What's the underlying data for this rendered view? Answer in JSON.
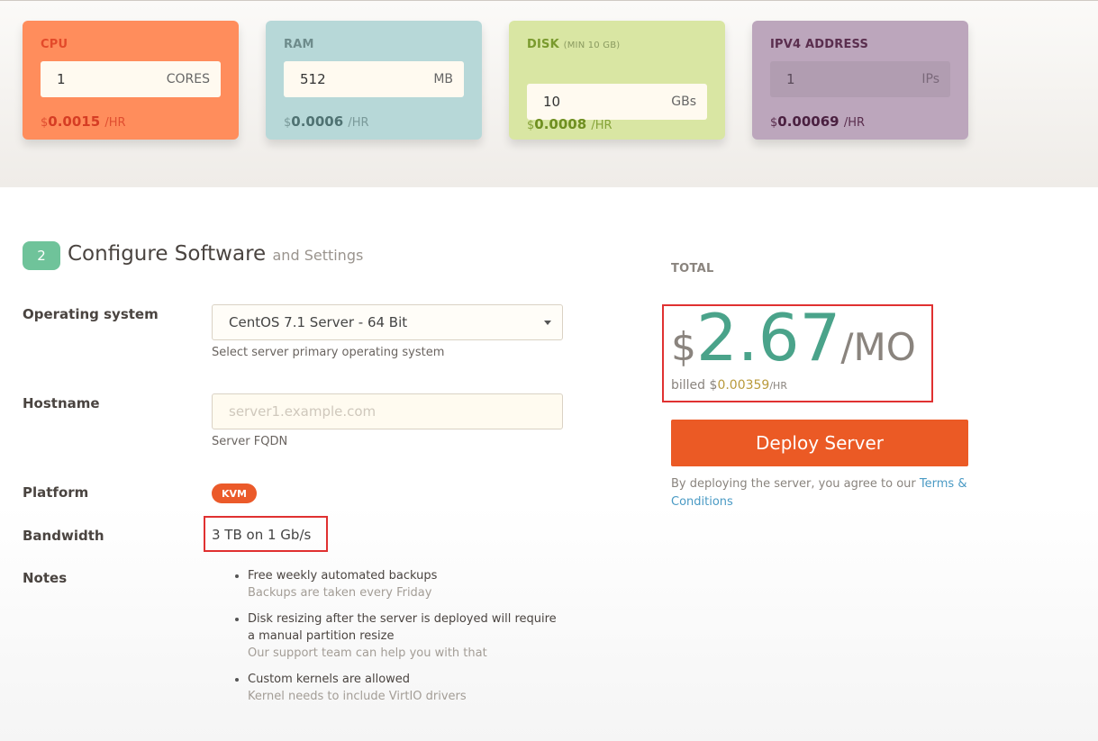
{
  "resources": {
    "cpu": {
      "title": "CPU",
      "value": "1",
      "unit": "CORES",
      "price_dollar": "$",
      "price": "0.0015",
      "per": "/HR"
    },
    "ram": {
      "title": "RAM",
      "value": "512",
      "unit": "MB",
      "price_dollar": "$",
      "price": "0.0006",
      "per": "/HR"
    },
    "disk": {
      "title": "DISK",
      "title_sub": "(MIN 10 GB)",
      "value": "10",
      "unit": "GBs",
      "price_dollar": "$",
      "price": "0.0008",
      "per": "/HR"
    },
    "ipv4": {
      "title": "IPV4 ADDRESS",
      "value": "1",
      "unit": "IPs",
      "price_dollar": "$",
      "price": "0.00069",
      "per": "/HR"
    }
  },
  "section": {
    "step": "2",
    "title": "Configure Software",
    "title_sub": "and Settings"
  },
  "form": {
    "os_label": "Operating system",
    "os_value": "CentOS 7.1 Server - 64 Bit",
    "os_help": "Select server primary operating system",
    "hostname_label": "Hostname",
    "hostname_placeholder": "server1.example.com",
    "hostname_help": "Server FQDN",
    "platform_label": "Platform",
    "platform_value": "KVM",
    "bandwidth_label": "Bandwidth",
    "bandwidth_value": "3 TB on 1 Gb/s",
    "notes_label": "Notes",
    "notes": [
      {
        "main": "Free weekly automated backups",
        "sub": "Backups are taken every Friday"
      },
      {
        "main": "Disk resizing after the server is deployed will require a manual partition resize",
        "sub": "Our support team can help you with that"
      },
      {
        "main": "Custom kernels are allowed",
        "sub": "Kernel needs to include VirtIO drivers"
      }
    ]
  },
  "total": {
    "label": "TOTAL",
    "currency": "$",
    "amount": "2.67",
    "period": "/MO",
    "billed_prefix": "billed",
    "billed_dollar": "$",
    "billed_amount": "0.00359",
    "billed_per": "/HR"
  },
  "deploy": {
    "button_label": "Deploy Server",
    "agree_text": "By deploying the server, you agree to our",
    "terms_link": "Terms & Conditions"
  },
  "colors": {
    "cpu": "#ff8d5c",
    "ram": "#b7d8d8",
    "disk": "#d9e6a3",
    "ipv4": "#bca6bc",
    "accent_green": "#6fc39a",
    "deploy_orange": "#eb5a25",
    "highlight_red": "#e03131"
  }
}
